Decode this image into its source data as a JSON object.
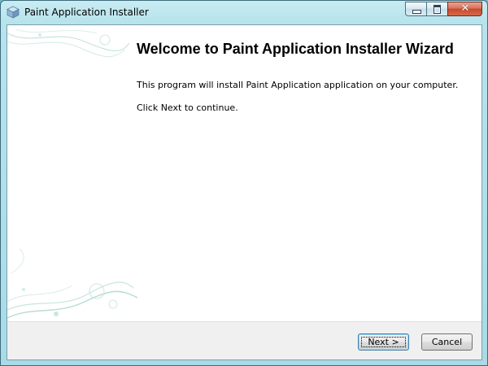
{
  "window": {
    "title": "Paint Application Installer",
    "icon": "installer-box-icon",
    "controls": {
      "minimize": "minimize-icon",
      "maximize": "maximize-icon",
      "close": "close-icon"
    },
    "close_symbol": "✕"
  },
  "wizard": {
    "heading": "Welcome to Paint Application Installer Wizard",
    "description": "This program will install Paint Application application on your computer.",
    "instruction": "Click Next to continue."
  },
  "buttons": {
    "next_label": "Next >",
    "cancel_label": "Cancel"
  },
  "colors": {
    "window_frame": "#a8dbe6",
    "close_button": "#c44a2f",
    "footer": "#f0f0f0",
    "decor": "#b5d9d3"
  }
}
